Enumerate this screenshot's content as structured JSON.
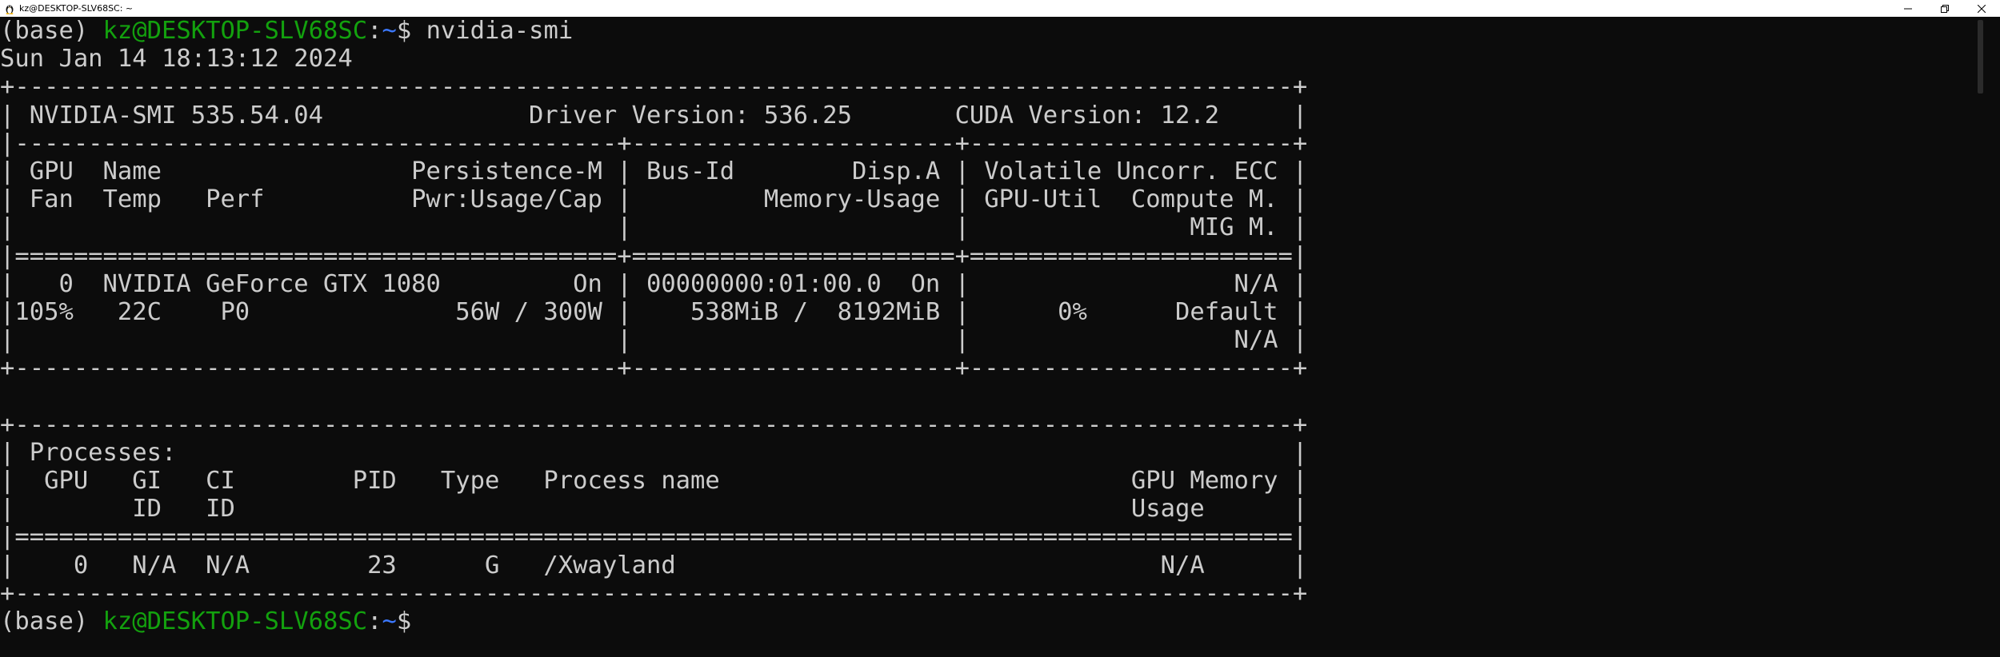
{
  "window": {
    "title": "kz@DESKTOP-SLV68SC: ~",
    "icons": {
      "app": "linux-penguin-icon",
      "minimize": "minimize-icon",
      "maximize": "restore-icon",
      "close": "close-icon"
    }
  },
  "terminal": {
    "prompt1": {
      "env": "(base) ",
      "user_host": "kz@DESKTOP-SLV68SC",
      "colon": ":",
      "path": "~",
      "dollar": "$ ",
      "command": "nvidia-smi"
    },
    "lines": [
      "Sun Jan 14 18:13:12 2024",
      "+---------------------------------------------------------------------------------------+",
      "| NVIDIA-SMI 535.54.04              Driver Version: 536.25       CUDA Version: 12.2     |",
      "|-----------------------------------------+----------------------+----------------------+",
      "| GPU  Name                 Persistence-M | Bus-Id        Disp.A | Volatile Uncorr. ECC |",
      "| Fan  Temp   Perf          Pwr:Usage/Cap |         Memory-Usage | GPU-Util  Compute M. |",
      "|                                         |                      |               MIG M. |",
      "|=========================================+======================+======================|",
      "|   0  NVIDIA GeForce GTX 1080         On | 00000000:01:00.0  On |                  N/A |",
      "|105%   22C    P0              56W / 300W |    538MiB /  8192MiB |      0%      Default |",
      "|                                         |                      |                  N/A |",
      "+-----------------------------------------+----------------------+----------------------+",
      "",
      "+---------------------------------------------------------------------------------------+",
      "| Processes:                                                                            |",
      "|  GPU   GI   CI        PID   Type   Process name                            GPU Memory |",
      "|        ID   ID                                                             Usage      |",
      "|=======================================================================================|",
      "|    0   N/A  N/A        23      G   /Xwayland                                 N/A      |",
      "+---------------------------------------------------------------------------------------+"
    ],
    "prompt2": {
      "env": "(base) ",
      "user_host": "kz@DESKTOP-SLV68SC",
      "colon": ":",
      "path": "~",
      "dollar": "$ "
    }
  }
}
